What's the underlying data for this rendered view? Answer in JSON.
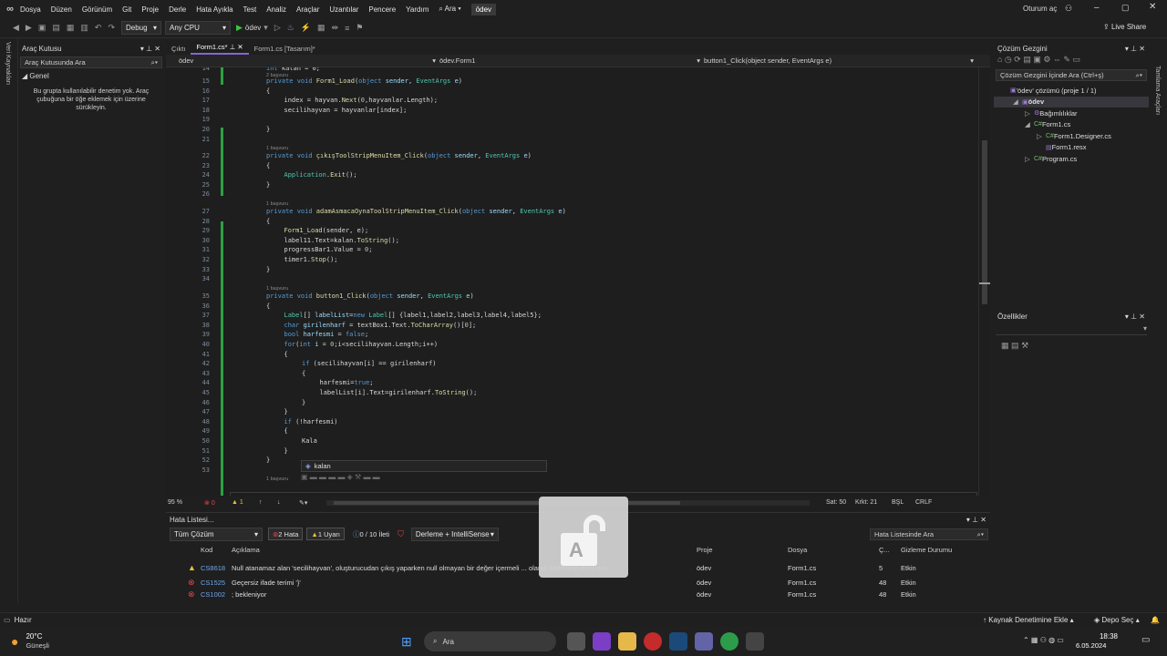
{
  "menu": [
    "Dosya",
    "Düzen",
    "Görünüm",
    "Git",
    "Proje",
    "Derle",
    "Hata Ayıkla",
    "Test",
    "Analiz",
    "Araçlar",
    "Uzantılar",
    "Pencere",
    "Yardım"
  ],
  "search_label": "Ara",
  "solution_name_tab": "ödev",
  "sign_in": "Oturum aç",
  "live_share": "Live Share",
  "toolbar": {
    "config": "Debug",
    "platform": "Any CPU",
    "run_label": "ödev"
  },
  "left_strip": "Veri Kaynakları",
  "right_strip": "Tamlama Araçları",
  "toolbox": {
    "title": "Araç Kutusu",
    "search": "Araç Kutusunda Ara",
    "group": "Genel",
    "empty_msg": "Bu grupta kullanılabilir denetim yok. Araç çubuğuna bir öğe eklemek için üzerine sürükleyin."
  },
  "doc_tabs": [
    {
      "label": "Çıktı"
    },
    {
      "label": "Form1.cs*"
    },
    {
      "label": "Form1.cs [Tasarım]*"
    }
  ],
  "nav": {
    "project": "ödev",
    "class": "ödev.Form1",
    "member": "button1_Click(object sender, EventArgs e)"
  },
  "code_lines": [
    {
      "n": "14",
      "html": "<span class='kw'>int</span> kalan = 0;",
      "indent": 2
    },
    {
      "n": "",
      "lens": "2 başvuru",
      "indent": 2
    },
    {
      "n": "15",
      "html": "<span class='kw'>private void</span> <span class='mt'>Form1_Load</span>(<span class='kw'>object</span> <span class='id'>sender</span>, <span class='ty'>EventArgs</span> <span class='id'>e</span>)",
      "indent": 2
    },
    {
      "n": "16",
      "html": "{",
      "indent": 2
    },
    {
      "n": "17",
      "html": "index = hayvan.<span class='mt'>Next</span>(<span class='nm'>0</span>,hayvanlar.Length);",
      "indent": 3
    },
    {
      "n": "18",
      "html": "secilihayvan = hayvanlar[index];",
      "indent": 3
    },
    {
      "n": "19",
      "html": "",
      "indent": 2
    },
    {
      "n": "20",
      "html": "}",
      "indent": 2
    },
    {
      "n": "21",
      "html": "",
      "indent": 2
    },
    {
      "n": "",
      "lens": "1 başvuru",
      "indent": 2
    },
    {
      "n": "22",
      "html": "<span class='kw'>private void</span> <span class='mt'>çıkışToolStripMenuItem_Click</span>(<span class='kw'>object</span> <span class='id'>sender</span>, <span class='ty'>EventArgs</span> <span class='id'>e</span>)",
      "indent": 2
    },
    {
      "n": "23",
      "html": "{",
      "indent": 2
    },
    {
      "n": "24",
      "html": "<span class='ty'>Application</span>.<span class='mt'>Exit</span>();",
      "indent": 3
    },
    {
      "n": "25",
      "html": "}",
      "indent": 2
    },
    {
      "n": "26",
      "html": "",
      "indent": 2
    },
    {
      "n": "",
      "lens": "1 başvuru",
      "indent": 2
    },
    {
      "n": "27",
      "html": "<span class='kw'>private void</span> <span class='mt'>adamAsmacaOynaToolStripMenuItem_Click</span>(<span class='kw'>object</span> <span class='id'>sender</span>, <span class='ty'>EventArgs</span> <span class='id'>e</span>)",
      "indent": 2
    },
    {
      "n": "28",
      "html": "{",
      "indent": 2
    },
    {
      "n": "29",
      "html": "<span class='mt'>Form1_Load</span>(sender, e);",
      "indent": 3
    },
    {
      "n": "30",
      "html": "label11.Text=kalan.<span class='mt'>ToString</span>();",
      "indent": 3
    },
    {
      "n": "31",
      "html": "progressBar1.Value = <span class='nm'>0</span>;",
      "indent": 3
    },
    {
      "n": "32",
      "html": "timer1.<span class='mt'>Stop</span>();",
      "indent": 3
    },
    {
      "n": "33",
      "html": "}",
      "indent": 2
    },
    {
      "n": "34",
      "html": "",
      "indent": 2
    },
    {
      "n": "",
      "lens": "1 başvuru",
      "indent": 2
    },
    {
      "n": "35",
      "html": "<span class='kw'>private void</span> <span class='mt'>button1_Click</span>(<span class='kw'>object</span> <span class='id'>sender</span>, <span class='ty'>EventArgs</span> <span class='id'>e</span>)",
      "indent": 2
    },
    {
      "n": "36",
      "html": "{",
      "indent": 2
    },
    {
      "n": "37",
      "html": "<span class='ty'>Label</span>[] <span class='id'>labelList</span>=<span class='kw'>new</span> <span class='ty'>Label</span>[] {label1,label2,label3,label4,label5};",
      "indent": 3
    },
    {
      "n": "38",
      "html": "<span class='kw'>char</span> <span class='id'>girilenharf</span> = textBox1.Text.<span class='mt'>ToCharArray</span>()[<span class='nm'>0</span>];",
      "indent": 3
    },
    {
      "n": "39",
      "html": "<span class='kw'>bool</span> <span class='id'>harfesmi</span> = <span class='kw'>false</span>;",
      "indent": 3
    },
    {
      "n": "40",
      "html": "<span class='kw'>for</span>(<span class='kw'>int</span> <span class='id'>i</span> = <span class='nm'>0</span>;i&lt;secilihayvan.Length;i++)",
      "indent": 3
    },
    {
      "n": "41",
      "html": "{",
      "indent": 3
    },
    {
      "n": "42",
      "html": "<span class='kw'>if</span> (secilihayvan[i] == girilenharf)",
      "indent": 4
    },
    {
      "n": "43",
      "html": "{",
      "indent": 4
    },
    {
      "n": "44",
      "html": "harfesmi=<span class='kw'>true</span>;",
      "indent": 5
    },
    {
      "n": "45",
      "html": "labelList[i].Text=girilenharf.<span class='mt'>ToString</span>();",
      "indent": 5
    },
    {
      "n": "46",
      "html": "}",
      "indent": 4
    },
    {
      "n": "47",
      "html": "}",
      "indent": 3
    },
    {
      "n": "48",
      "html": "<span class='kw'>if</span> (!harfesmi)",
      "indent": 3
    },
    {
      "n": "49",
      "html": "{",
      "indent": 3
    },
    {
      "n": "50",
      "html": "Kala",
      "indent": 4
    },
    {
      "n": "51",
      "html": "}",
      "indent": 3
    },
    {
      "n": "52",
      "html": "}",
      "indent": 2
    },
    {
      "n": "53",
      "html": "",
      "indent": 2
    },
    {
      "n": "",
      "lens": "1 başvuru",
      "indent": 2
    }
  ],
  "intellisense": {
    "item": "kalan"
  },
  "editor_status": {
    "zoom": "95 %",
    "errors": "0",
    "warnings": "1",
    "line": "Sat: 50",
    "col": "Krkt: 21",
    "mode": "BŞL",
    "eol": "CRLF"
  },
  "solution": {
    "title": "Çözüm Gezgini",
    "search": "Çözüm Gezgini İçinde Ara (Ctrl+ş)",
    "items": [
      {
        "label": "'ödev' çözümü (proje 1 / 1)",
        "level": 0
      },
      {
        "label": "ödev",
        "level": 1,
        "bold": true
      },
      {
        "label": "Bağımlılıklar",
        "level": 2
      },
      {
        "label": "Form1.cs",
        "level": 2
      },
      {
        "label": "Form1.Designer.cs",
        "level": 3
      },
      {
        "label": "Form1.resx",
        "level": 3
      },
      {
        "label": "Program.cs",
        "level": 2
      }
    ]
  },
  "properties": {
    "title": "Özellikler"
  },
  "errors": {
    "title": "Hata Listesi...",
    "scope": "Tüm Çözüm",
    "err_btn": "2 Hata",
    "warn_btn": "1 Uyarı",
    "msg_btn": "0 / 10 İleti",
    "build_filter": "Derleme + IntelliSense",
    "search": "Hata Listesinde Ara",
    "headers": [
      "Kod",
      "Açıklama",
      "Proje",
      "Dosya",
      "Ç...",
      "Gizleme Durumu"
    ],
    "rows": [
      {
        "type": "warning",
        "code": "CS8618",
        "desc": "Null atanamaz alan 'secilihayvan', oluşturucudan çıkış yaparken null olmayan bir değer içermeli ... olarak bildirmeyi düşünün.",
        "project": "ödev",
        "file": "Form1.cs",
        "col": "5",
        "state": "Etkin"
      },
      {
        "type": "error",
        "code": "CS1525",
        "desc": "Geçersiz ifade terimi '}'",
        "project": "ödev",
        "file": "Form1.cs",
        "col": "48",
        "state": "Etkin"
      },
      {
        "type": "error",
        "code": "CS1002",
        "desc": "; bekleniyor",
        "project": "ödev",
        "file": "Form1.cs",
        "col": "48",
        "state": "Etkin"
      }
    ]
  },
  "status": {
    "ready": "Hazır",
    "source_control": "Kaynak Denetimine Ekle",
    "repo": "Depo Seç"
  },
  "taskbar": {
    "temp": "20°C",
    "weather": "Güneşli",
    "search": "Ara",
    "time": "18:38",
    "date": "6.05.2024"
  },
  "overlay_glyph": "A"
}
